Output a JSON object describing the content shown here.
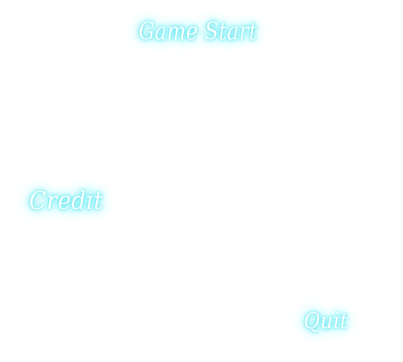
{
  "menu": {
    "start_label": "Game Start",
    "credit_label": "Credit",
    "quit_label": "Quit"
  },
  "colors": {
    "background": "#ffffff",
    "text": "#ffffff",
    "glow": "#4fe3ec"
  }
}
